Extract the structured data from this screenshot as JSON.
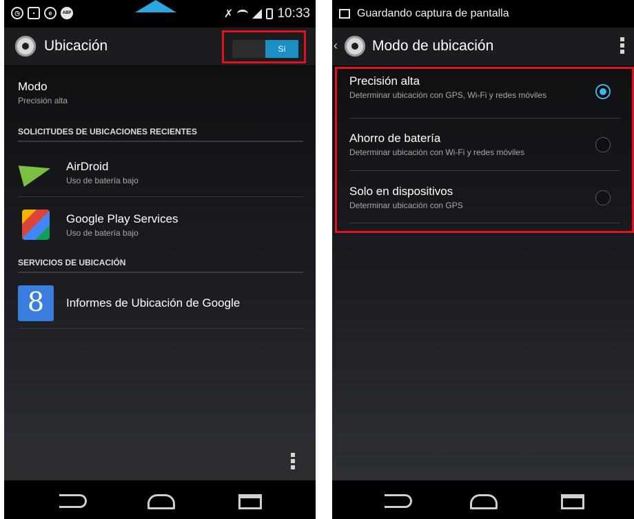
{
  "left": {
    "status_time": "10:33",
    "status_icons": [
      "alarm-icon",
      "gallery-icon",
      "circle-e-icon",
      "abp-icon",
      "mute-icon",
      "wifi-icon",
      "signal-icon",
      "battery-icon"
    ],
    "status_icon_labels": {
      "abp": "ABP"
    },
    "title": "Ubicación",
    "toggle_label": "Sí",
    "modo_title": "Modo",
    "modo_value": "Precisión alta",
    "section_recent": "SOLICITUDES DE UBICACIONES RECIENTES",
    "apps": [
      {
        "name": "AirDroid",
        "detail": "Uso de batería bajo",
        "icon": "airdroid-plane-icon"
      },
      {
        "name": "Google Play Services",
        "detail": "Uso de batería bajo",
        "icon": "google-play-services-icon"
      }
    ],
    "section_services": "SERVICIOS DE UBICACIÓN",
    "service": {
      "name": "Informes de Ubicación de Google",
      "icon": "google-location-icon",
      "icon_letter": "8"
    }
  },
  "right": {
    "status_text": "Guardando captura de pantalla",
    "title": "Modo de ubicación",
    "options": [
      {
        "title": "Precisión alta",
        "description": "Determinar ubicación con GPS, Wi-Fi y redes móviles",
        "selected": true
      },
      {
        "title": "Ahorro de batería",
        "description": "Determinar ubicación con Wi-Fi y redes móviles",
        "selected": false
      },
      {
        "title": "Solo en dispositivos",
        "description": "Determinar ubicación con GPS",
        "selected": false
      }
    ]
  },
  "colors": {
    "accent": "#1b8fc4",
    "highlight": "#e3111b",
    "radio": "#41b6e6"
  }
}
